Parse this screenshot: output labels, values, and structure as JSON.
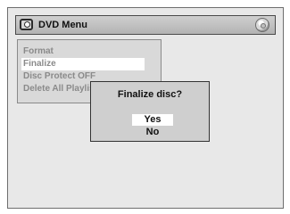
{
  "header": {
    "icon": "dvd-icon",
    "title": "DVD Menu",
    "disc_icon": "disc-icon"
  },
  "menu": {
    "items": [
      {
        "label": "Format",
        "selected": false
      },
      {
        "label": "Finalize",
        "selected": true
      },
      {
        "label": "Disc Protect OFF",
        "selected": false
      },
      {
        "label": "Delete All Playlists",
        "selected": false
      }
    ]
  },
  "dialog": {
    "title": "Finalize disc?",
    "options": [
      {
        "label": "Yes",
        "selected": true
      },
      {
        "label": "No",
        "selected": false
      }
    ]
  },
  "colors": {
    "screen_bg": "#e8e8e8",
    "menu_text": "#8a8a8a",
    "highlight": "#ffffff"
  }
}
